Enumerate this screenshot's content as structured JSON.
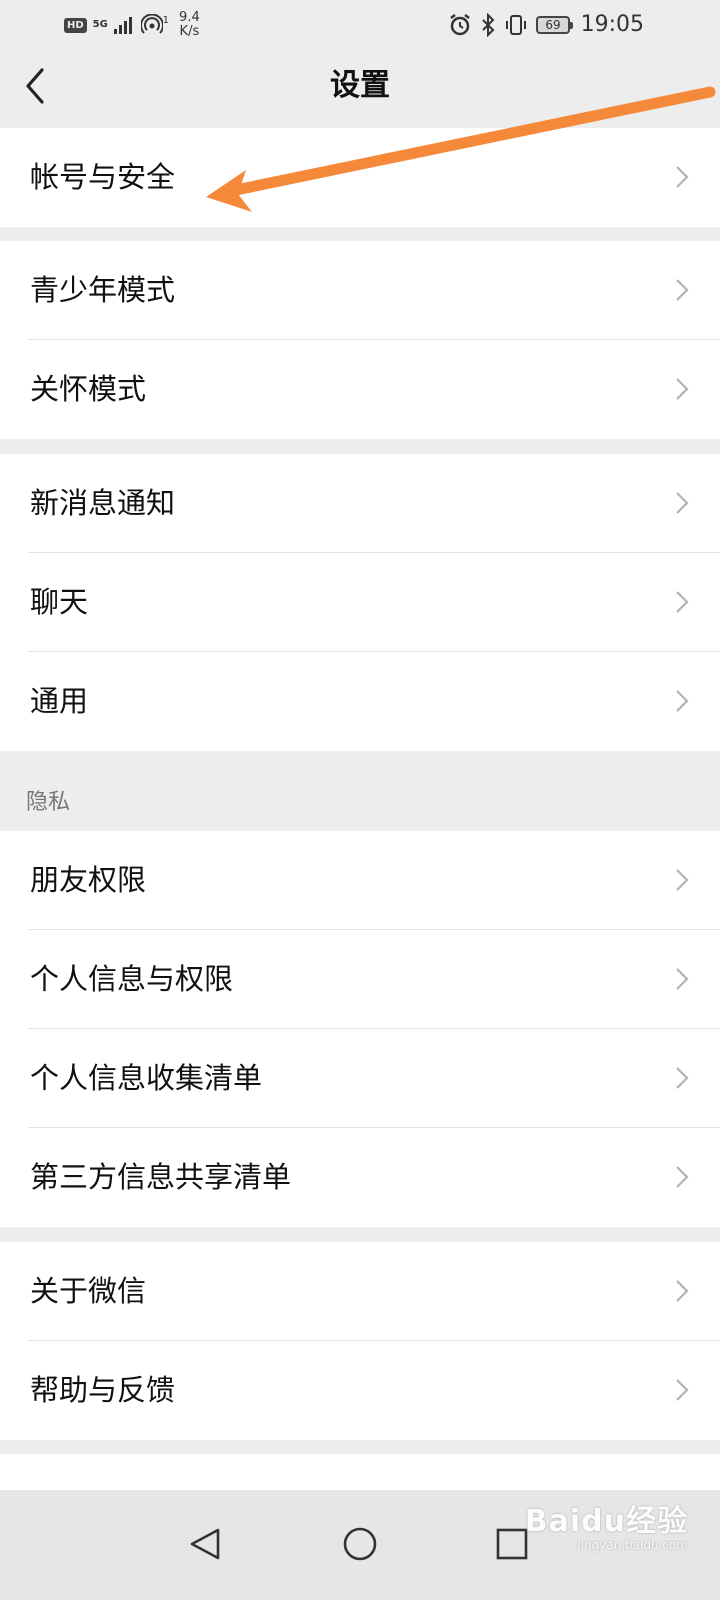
{
  "status_bar": {
    "hd": "HD",
    "network": "5G",
    "speed_value": "9.4",
    "speed_unit": "K/s",
    "hotspot_count": "1",
    "battery": "69",
    "time": "19:05",
    "icons": [
      "signal-icon",
      "hotspot-icon",
      "alarm-icon",
      "bluetooth-icon",
      "vibrate-icon",
      "battery-icon"
    ]
  },
  "header": {
    "title": "设置"
  },
  "groups": [
    {
      "items": [
        {
          "label": "帐号与安全"
        }
      ]
    },
    {
      "items": [
        {
          "label": "青少年模式"
        },
        {
          "label": "关怀模式"
        }
      ]
    },
    {
      "items": [
        {
          "label": "新消息通知"
        },
        {
          "label": "聊天"
        },
        {
          "label": "通用"
        }
      ]
    },
    {
      "section": "隐私",
      "items": [
        {
          "label": "朋友权限"
        },
        {
          "label": "个人信息与权限"
        },
        {
          "label": "个人信息收集清单"
        },
        {
          "label": "第三方信息共享清单"
        }
      ]
    },
    {
      "items": [
        {
          "label": "关于微信"
        },
        {
          "label": "帮助与反馈"
        }
      ]
    }
  ],
  "annotation": {
    "color": "#f5893a"
  },
  "watermark": {
    "main": "Baidu经验",
    "sub": "jingyan.baidu.com"
  },
  "colors": {
    "background": "#ededed",
    "row": "#ffffff",
    "divider": "#e0e0e0"
  }
}
